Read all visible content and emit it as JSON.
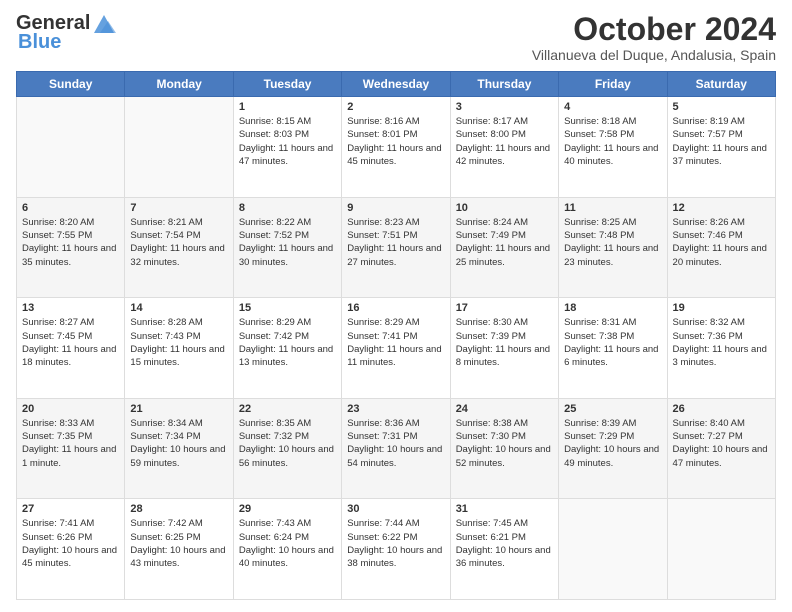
{
  "header": {
    "logo_general": "General",
    "logo_blue": "Blue",
    "month": "October 2024",
    "location": "Villanueva del Duque, Andalusia, Spain"
  },
  "days_of_week": [
    "Sunday",
    "Monday",
    "Tuesday",
    "Wednesday",
    "Thursday",
    "Friday",
    "Saturday"
  ],
  "weeks": [
    [
      {
        "day": "",
        "info": ""
      },
      {
        "day": "",
        "info": ""
      },
      {
        "day": "1",
        "info": "Sunrise: 8:15 AM\nSunset: 8:03 PM\nDaylight: 11 hours and 47 minutes."
      },
      {
        "day": "2",
        "info": "Sunrise: 8:16 AM\nSunset: 8:01 PM\nDaylight: 11 hours and 45 minutes."
      },
      {
        "day": "3",
        "info": "Sunrise: 8:17 AM\nSunset: 8:00 PM\nDaylight: 11 hours and 42 minutes."
      },
      {
        "day": "4",
        "info": "Sunrise: 8:18 AM\nSunset: 7:58 PM\nDaylight: 11 hours and 40 minutes."
      },
      {
        "day": "5",
        "info": "Sunrise: 8:19 AM\nSunset: 7:57 PM\nDaylight: 11 hours and 37 minutes."
      }
    ],
    [
      {
        "day": "6",
        "info": "Sunrise: 8:20 AM\nSunset: 7:55 PM\nDaylight: 11 hours and 35 minutes."
      },
      {
        "day": "7",
        "info": "Sunrise: 8:21 AM\nSunset: 7:54 PM\nDaylight: 11 hours and 32 minutes."
      },
      {
        "day": "8",
        "info": "Sunrise: 8:22 AM\nSunset: 7:52 PM\nDaylight: 11 hours and 30 minutes."
      },
      {
        "day": "9",
        "info": "Sunrise: 8:23 AM\nSunset: 7:51 PM\nDaylight: 11 hours and 27 minutes."
      },
      {
        "day": "10",
        "info": "Sunrise: 8:24 AM\nSunset: 7:49 PM\nDaylight: 11 hours and 25 minutes."
      },
      {
        "day": "11",
        "info": "Sunrise: 8:25 AM\nSunset: 7:48 PM\nDaylight: 11 hours and 23 minutes."
      },
      {
        "day": "12",
        "info": "Sunrise: 8:26 AM\nSunset: 7:46 PM\nDaylight: 11 hours and 20 minutes."
      }
    ],
    [
      {
        "day": "13",
        "info": "Sunrise: 8:27 AM\nSunset: 7:45 PM\nDaylight: 11 hours and 18 minutes."
      },
      {
        "day": "14",
        "info": "Sunrise: 8:28 AM\nSunset: 7:43 PM\nDaylight: 11 hours and 15 minutes."
      },
      {
        "day": "15",
        "info": "Sunrise: 8:29 AM\nSunset: 7:42 PM\nDaylight: 11 hours and 13 minutes."
      },
      {
        "day": "16",
        "info": "Sunrise: 8:29 AM\nSunset: 7:41 PM\nDaylight: 11 hours and 11 minutes."
      },
      {
        "day": "17",
        "info": "Sunrise: 8:30 AM\nSunset: 7:39 PM\nDaylight: 11 hours and 8 minutes."
      },
      {
        "day": "18",
        "info": "Sunrise: 8:31 AM\nSunset: 7:38 PM\nDaylight: 11 hours and 6 minutes."
      },
      {
        "day": "19",
        "info": "Sunrise: 8:32 AM\nSunset: 7:36 PM\nDaylight: 11 hours and 3 minutes."
      }
    ],
    [
      {
        "day": "20",
        "info": "Sunrise: 8:33 AM\nSunset: 7:35 PM\nDaylight: 11 hours and 1 minute."
      },
      {
        "day": "21",
        "info": "Sunrise: 8:34 AM\nSunset: 7:34 PM\nDaylight: 10 hours and 59 minutes."
      },
      {
        "day": "22",
        "info": "Sunrise: 8:35 AM\nSunset: 7:32 PM\nDaylight: 10 hours and 56 minutes."
      },
      {
        "day": "23",
        "info": "Sunrise: 8:36 AM\nSunset: 7:31 PM\nDaylight: 10 hours and 54 minutes."
      },
      {
        "day": "24",
        "info": "Sunrise: 8:38 AM\nSunset: 7:30 PM\nDaylight: 10 hours and 52 minutes."
      },
      {
        "day": "25",
        "info": "Sunrise: 8:39 AM\nSunset: 7:29 PM\nDaylight: 10 hours and 49 minutes."
      },
      {
        "day": "26",
        "info": "Sunrise: 8:40 AM\nSunset: 7:27 PM\nDaylight: 10 hours and 47 minutes."
      }
    ],
    [
      {
        "day": "27",
        "info": "Sunrise: 7:41 AM\nSunset: 6:26 PM\nDaylight: 10 hours and 45 minutes."
      },
      {
        "day": "28",
        "info": "Sunrise: 7:42 AM\nSunset: 6:25 PM\nDaylight: 10 hours and 43 minutes."
      },
      {
        "day": "29",
        "info": "Sunrise: 7:43 AM\nSunset: 6:24 PM\nDaylight: 10 hours and 40 minutes."
      },
      {
        "day": "30",
        "info": "Sunrise: 7:44 AM\nSunset: 6:22 PM\nDaylight: 10 hours and 38 minutes."
      },
      {
        "day": "31",
        "info": "Sunrise: 7:45 AM\nSunset: 6:21 PM\nDaylight: 10 hours and 36 minutes."
      },
      {
        "day": "",
        "info": ""
      },
      {
        "day": "",
        "info": ""
      }
    ]
  ]
}
